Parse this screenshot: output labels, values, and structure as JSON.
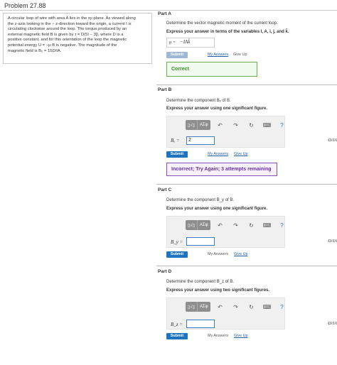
{
  "problem": {
    "title": "Problem 27.88",
    "statement_lines": [
      "A circular loop of wire with area A lies in the xy-plane. As viewed along",
      "the z-axis looking in the − z-direction toward the origin, a current I is",
      "circulating clockwise around the loop. The torque produced by an",
      "external magnetic field B is given by τ = D(5î − 3ĵ), where D is a",
      "positive constant, and for this orientation of the loop the magnetic",
      "potential energy U = −μ·B is negative. The magnitude of the",
      "magnetic field is B₀ = 15D/IA."
    ]
  },
  "part_a": {
    "label": "Part A",
    "question": "Determine the vector magnetic moment of the current loop.",
    "instruction": "Express your answer in terms of the variables I, A, î, ĵ, and k̂.",
    "answer_prefix": "μ =",
    "answer_value": "−IAk̂",
    "submit_label": "Submit",
    "my_answers_label": "My Answers",
    "give_up_label": "Give Up",
    "feedback": "Correct"
  },
  "part_b": {
    "label": "Part B",
    "question": "Determine the component Bₓ of B.",
    "instruction": "Express your answer using one significant figure.",
    "var_label": "Bₓ =",
    "input_value": "2",
    "unit": "·D/IA",
    "submit_label": "Submit",
    "my_answers_label": "My Answers",
    "give_up_label": "Give Up",
    "feedback": "Incorrect; Try Again; 3 attempts remaining"
  },
  "part_c": {
    "label": "Part C",
    "question": "Determine the component B_y of B.",
    "instruction": "Express your answer using one significant figure.",
    "var_label": "B_y =",
    "input_value": "",
    "unit": "·D/IA",
    "submit_label": "Submit",
    "my_answers_label": "My Answers",
    "give_up_label": "Give Up"
  },
  "part_d": {
    "label": "Part D",
    "question": "Determine the component B_z of B.",
    "instruction": "Express your answer using two significant figures.",
    "var_label": "B_z =",
    "input_value": "",
    "unit": "·D/IA",
    "submit_label": "Submit",
    "my_answers_label": "My Answers",
    "give_up_label": "Give Up"
  },
  "toolbar": {
    "templates_label": "▯√▯",
    "symbols_label": "ΑΣφ",
    "undo_icon": "↶",
    "redo_icon": "↷",
    "reset_icon": "↻",
    "keyboard_icon": "⌨",
    "help_icon": "?"
  },
  "colors": {
    "submit_blue": "#1f74c2",
    "correct_green": "#3a8a22",
    "incorrect_purple": "#6a2ea3"
  }
}
